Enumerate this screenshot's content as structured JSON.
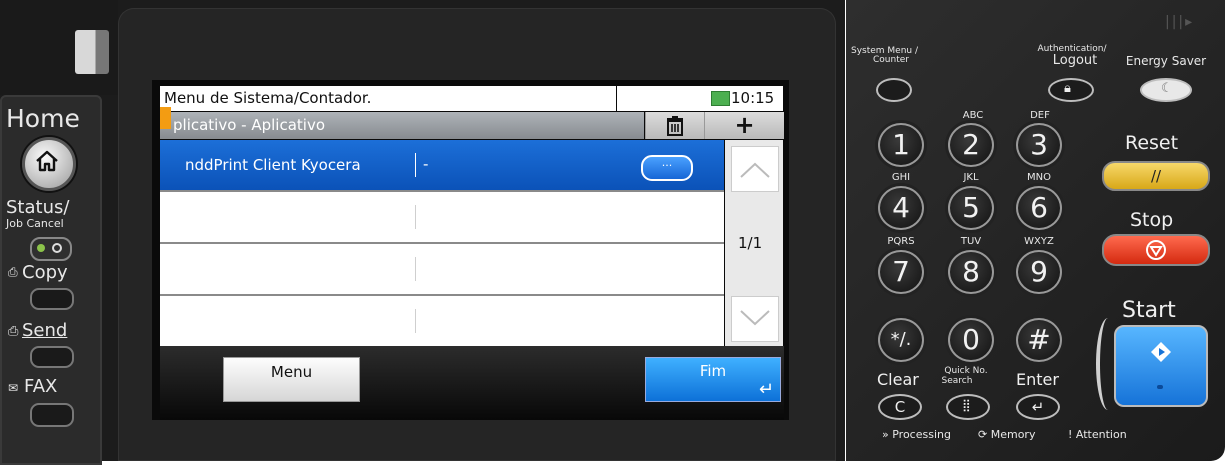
{
  "left_panel": {
    "home_label": "Home",
    "status_label": "Status/",
    "job_cancel_label": "Job Cancel",
    "copy_label": "Copy",
    "send_label": "Send",
    "fax_label": "FAX"
  },
  "screen": {
    "title": "Menu de Sistema/Contador.",
    "time": "10:15",
    "subtitle": "plicativo - Aplicativo",
    "rows": [
      {
        "name": "nddPrint Client Kyocera",
        "value": "-"
      },
      {
        "name": "",
        "value": ""
      },
      {
        "name": "",
        "value": ""
      },
      {
        "name": "",
        "value": ""
      }
    ],
    "more_button": "···",
    "page_indicator": "1/1",
    "menu_button": "Menu",
    "fim_button": "Fim",
    "plus_label": "+"
  },
  "keypad": {
    "system_menu_label": "System Menu /",
    "counter_label": "Counter",
    "authentication_label": "Authentication/",
    "logout_label": "Logout",
    "energy_saver_label": "Energy Saver",
    "reset_label": "Reset",
    "stop_label": "Stop",
    "start_label": "Start",
    "clear_label": "Clear",
    "quick_no_label": "Quick No.",
    "search_label": "Search",
    "enter_label": "Enter",
    "keys": [
      {
        "num": "1",
        "letters": ""
      },
      {
        "num": "2",
        "letters": "ABC"
      },
      {
        "num": "3",
        "letters": "DEF"
      },
      {
        "num": "4",
        "letters": "GHI"
      },
      {
        "num": "5",
        "letters": "JKL"
      },
      {
        "num": "6",
        "letters": "MNO"
      },
      {
        "num": "7",
        "letters": "PQRS"
      },
      {
        "num": "8",
        "letters": "TUV"
      },
      {
        "num": "9",
        "letters": "WXYZ"
      },
      {
        "num": "*/.",
        "letters": ""
      },
      {
        "num": "0",
        "letters": ""
      },
      {
        "num": "#",
        "letters": ""
      }
    ],
    "processing_label": "Processing",
    "memory_label": "Memory",
    "attention_label": "Attention"
  }
}
